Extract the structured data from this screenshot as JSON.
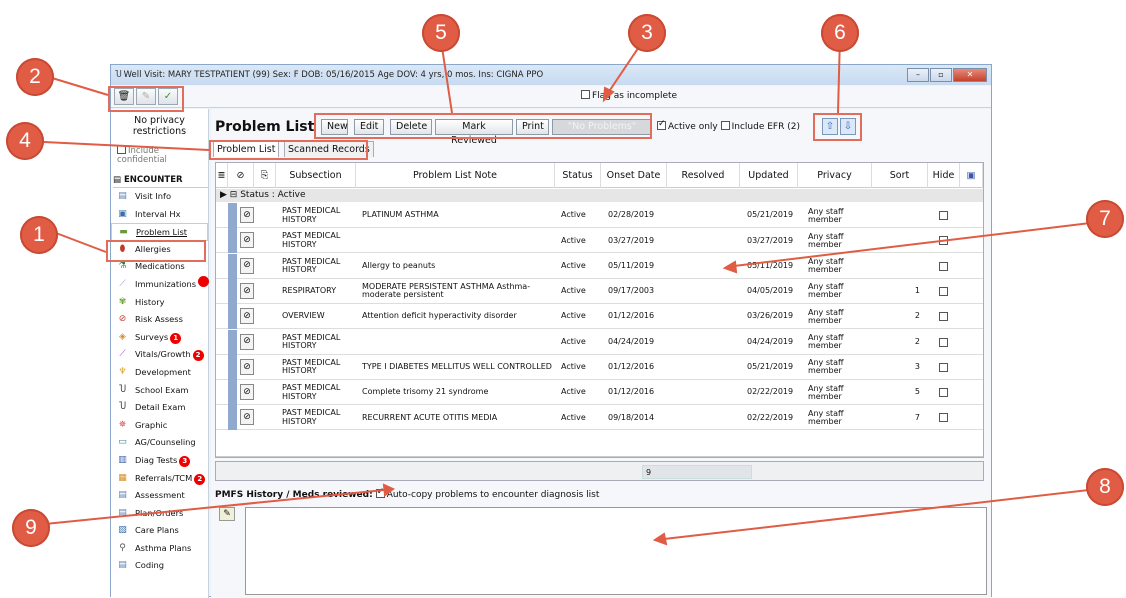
{
  "window": {
    "title": "Well Visit: MARY TESTPATIENT (99)  Sex: F  DOB: 05/16/2015  Age DOV: 4 yrs, 0 mos.  Ins: CIGNA PPO",
    "min": "–",
    "max": "▫",
    "close": "✕"
  },
  "toolbar": {
    "delete_icon": "🗑",
    "edit_icon": "✎",
    "ok_icon": "✓",
    "flag_label": "Flag as incomplete"
  },
  "sidebar": {
    "privacy": "No privacy restrictions",
    "include_confidential": "Include confidential",
    "section": "ENCOUNTER",
    "items": [
      {
        "label": "Visit Info",
        "icon": "visit-info-icon",
        "glyph": "▤",
        "color": "#5a7fb0"
      },
      {
        "label": "Interval Hx",
        "icon": "interval-icon",
        "glyph": "▣",
        "color": "#3a6ea8"
      },
      {
        "label": "Problem List",
        "icon": "problem-list-icon",
        "glyph": "▬",
        "color": "#6a9a3a"
      },
      {
        "label": "Allergies",
        "icon": "allergies-icon",
        "glyph": "⬮",
        "color": "#c0392b"
      },
      {
        "label": "Medications",
        "icon": "medications-icon",
        "glyph": "⚗",
        "color": "#2f7d4a"
      },
      {
        "label": "Immunizations",
        "icon": "immunizations-icon",
        "glyph": "⟋",
        "color": "#8aa3c8"
      },
      {
        "label": "History",
        "icon": "history-icon",
        "glyph": "✾",
        "color": "#6aa033"
      },
      {
        "label": "Risk Assess",
        "icon": "risk-icon",
        "glyph": "⊘",
        "color": "#cc3a2a"
      },
      {
        "label": "Surveys",
        "icon": "surveys-icon",
        "glyph": "◈",
        "color": "#d98c1e"
      },
      {
        "label": "Vitals/Growth",
        "icon": "vitals-icon",
        "glyph": "⟋",
        "color": "#b04acc"
      },
      {
        "label": "Development",
        "icon": "development-icon",
        "glyph": "♆",
        "color": "#d9a01e"
      },
      {
        "label": "School Exam",
        "icon": "school-exam-icon",
        "glyph": "Ⴎ",
        "color": "#333"
      },
      {
        "label": "Detail Exam",
        "icon": "detail-exam-icon",
        "glyph": "Ⴎ",
        "color": "#333"
      },
      {
        "label": "Graphic",
        "icon": "graphic-icon",
        "glyph": "✵",
        "color": "#c44"
      },
      {
        "label": "AG/Counseling",
        "icon": "counseling-icon",
        "glyph": "▭",
        "color": "#3a7a9a"
      },
      {
        "label": "Diag Tests",
        "icon": "diag-tests-icon",
        "glyph": "▥",
        "color": "#3a5aa8"
      },
      {
        "label": "Referrals/TCM",
        "icon": "referrals-icon",
        "glyph": "▦",
        "color": "#d98c1e"
      },
      {
        "label": "Assessment",
        "icon": "assessment-icon",
        "glyph": "▤",
        "color": "#5a7fb0"
      },
      {
        "label": "Plan/Orders",
        "icon": "plan-icon",
        "glyph": "▤",
        "color": "#5a7fb0"
      },
      {
        "label": "Care Plans",
        "icon": "care-plans-icon",
        "glyph": "▧",
        "color": "#3a6ea8"
      },
      {
        "label": "Asthma Plans",
        "icon": "asthma-plans-icon",
        "glyph": "⚲",
        "color": "#555"
      },
      {
        "label": "Coding",
        "icon": "coding-icon",
        "glyph": "▤",
        "color": "#5a7fb0"
      }
    ],
    "badges": {
      "immunizations": "",
      "surveys": "1",
      "vitals": "2",
      "diag": "3",
      "referrals": "2"
    }
  },
  "main": {
    "title": "Problem List",
    "actions": {
      "new": "New",
      "edit": "Edit",
      "delete": "Delete",
      "mark": "Mark Reviewed",
      "print": "Print",
      "no_problems": "\"No Problems\""
    },
    "active_only": "Active only",
    "include_efr": "Include EFR (2)",
    "up": "⇧",
    "down": "⇩",
    "tabs": {
      "problem_list": "Problem List",
      "scanned": "Scanned Records"
    },
    "grid": {
      "headers": {
        "menu": "≣",
        "attach": "⊘",
        "note": "⎘",
        "subsection": "Subsection",
        "note_h": "Problem List Note",
        "status": "Status",
        "onset": "Onset Date",
        "resolved": "Resolved",
        "updated": "Updated",
        "privacy": "Privacy",
        "sort": "Sort",
        "hide": "Hide",
        "save": "▣"
      },
      "group": "Status : Active",
      "group_toggle": "⊟",
      "group_arrow": "▶",
      "rows": [
        {
          "sub": "PAST MEDICAL HISTORY",
          "note": "PLATINUM ASTHMA",
          "status": "Active",
          "onset": "02/28/2019",
          "resolved": "",
          "updated": "05/21/2019",
          "privacy": "Any staff member",
          "sort": ""
        },
        {
          "sub": "PAST MEDICAL HISTORY",
          "note": "",
          "status": "Active",
          "onset": "03/27/2019",
          "resolved": "",
          "updated": "03/27/2019",
          "privacy": "Any staff member",
          "sort": ""
        },
        {
          "sub": "PAST MEDICAL HISTORY",
          "note": "Allergy to peanuts",
          "status": "Active",
          "onset": "05/11/2019",
          "resolved": "",
          "updated": "05/11/2019",
          "privacy": "Any staff member",
          "sort": ""
        },
        {
          "sub": "RESPIRATORY",
          "note": "MODERATE PERSISTENT ASTHMA Asthma-moderate persistent",
          "status": "Active",
          "onset": "09/17/2003",
          "resolved": "",
          "updated": "04/05/2019",
          "privacy": "Any staff member",
          "sort": "1"
        },
        {
          "sub": "OVERVIEW",
          "note": "Attention deficit hyperactivity disorder",
          "status": "Active",
          "onset": "01/12/2016",
          "resolved": "",
          "updated": "03/26/2019",
          "privacy": "Any staff member",
          "sort": "2"
        },
        {
          "sub": "PAST MEDICAL HISTORY",
          "note": "",
          "status": "Active",
          "onset": "04/24/2019",
          "resolved": "",
          "updated": "04/24/2019",
          "privacy": "Any staff member",
          "sort": "2"
        },
        {
          "sub": "PAST MEDICAL HISTORY",
          "note": "TYPE I DIABETES MELLITUS WELL CONTROLLED",
          "status": "Active",
          "onset": "01/12/2016",
          "resolved": "",
          "updated": "05/21/2019",
          "privacy": "Any staff member",
          "sort": "3"
        },
        {
          "sub": "PAST MEDICAL HISTORY",
          "note": "Complete trisomy 21 syndrome",
          "status": "Active",
          "onset": "01/12/2016",
          "resolved": "",
          "updated": "02/22/2019",
          "privacy": "Any staff member",
          "sort": "5"
        },
        {
          "sub": "PAST MEDICAL HISTORY",
          "note": "RECURRENT ACUTE OTITIS MEDIA",
          "status": "Active",
          "onset": "09/18/2014",
          "resolved": "",
          "updated": "02/22/2019",
          "privacy": "Any staff member",
          "sort": "7"
        }
      ],
      "count": "9"
    },
    "pmfs_label": "PMFS History / Meds reviewed:",
    "autocopy": "Auto-copy problems to encounter diagnosis list",
    "note_icon": "✎"
  },
  "callouts": [
    "1",
    "2",
    "3",
    "4",
    "5",
    "6",
    "7",
    "8",
    "9"
  ],
  "colors": {
    "callout": "#e05c45"
  }
}
